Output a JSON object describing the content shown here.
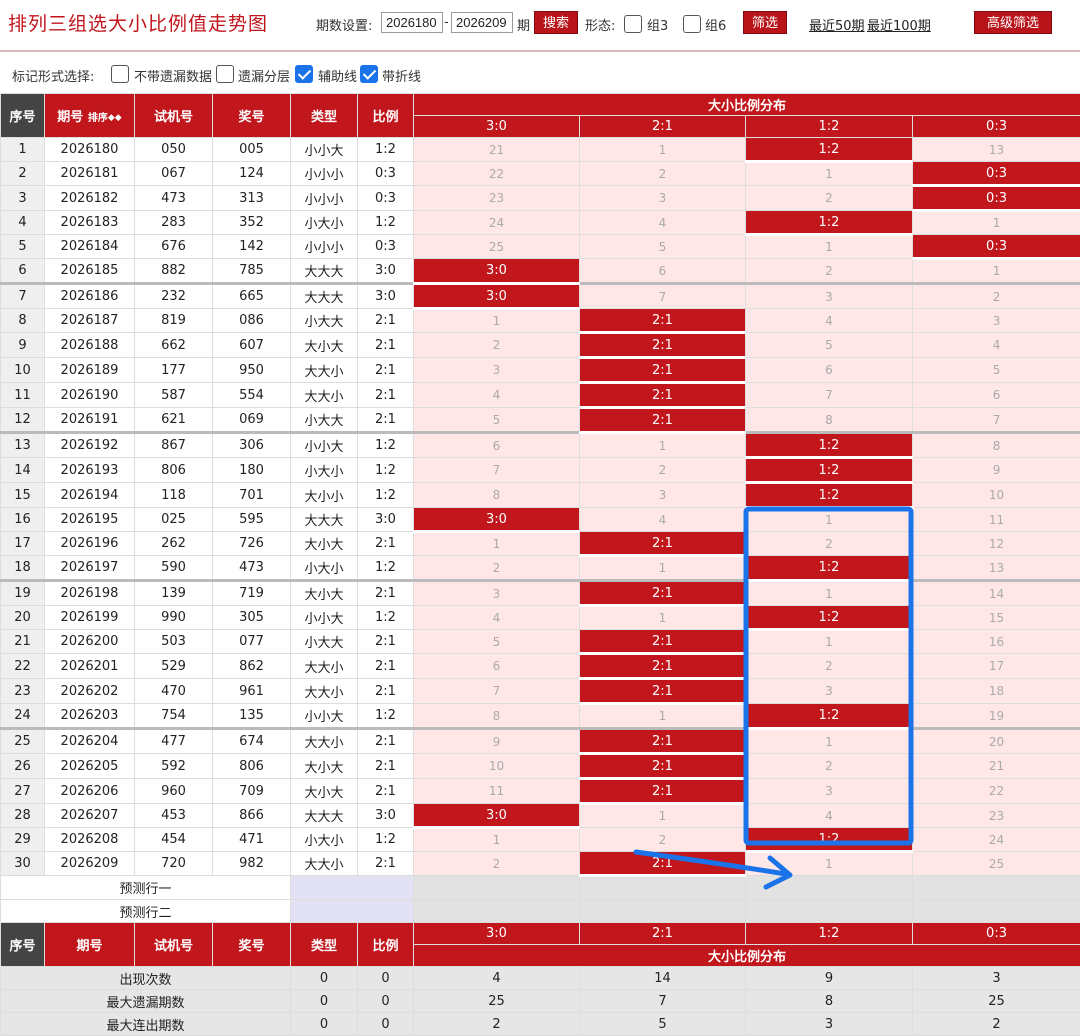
{
  "header": {
    "title": "排列三组选大小比例值走势图",
    "period_label": "期数设置:",
    "period_from": "2026180",
    "period_sep": "-",
    "period_to": "2026209",
    "period_unit": "期",
    "search_label": "搜索",
    "form_label": "形态:",
    "group3_label": "组3",
    "group6_label": "组6",
    "filter_label": "筛选",
    "recent50_label": "最近50期",
    "recent100_label": "最近100期",
    "advanced_label": "高级筛选"
  },
  "options": {
    "label": "标记形式选择:",
    "items": [
      {
        "label": "不带遗漏数据",
        "checked": false
      },
      {
        "label": "遗漏分层",
        "checked": false
      },
      {
        "label": "辅助线",
        "checked": true
      },
      {
        "label": "带折线",
        "checked": true
      }
    ]
  },
  "table": {
    "headers": {
      "seq": "序号",
      "period": "期号",
      "sort": "排序",
      "trial": "试机号",
      "prize": "奖号",
      "type": "类型",
      "ratio": "比例",
      "dist": "大小比例分布"
    },
    "dist_cols": [
      "3:0",
      "2:1",
      "1:2",
      "0:3"
    ],
    "rows": [
      {
        "seq": "1",
        "period": "2026180",
        "trial": "050",
        "prize": "005",
        "type": "小小大",
        "ratio": "1:2",
        "dist": [
          "21",
          "1",
          "1:2",
          "13"
        ],
        "hit": 2
      },
      {
        "seq": "2",
        "period": "2026181",
        "trial": "067",
        "prize": "124",
        "type": "小小小",
        "ratio": "0:3",
        "dist": [
          "22",
          "2",
          "1",
          "0:3"
        ],
        "hit": 3
      },
      {
        "seq": "3",
        "period": "2026182",
        "trial": "473",
        "prize": "313",
        "type": "小小小",
        "ratio": "0:3",
        "dist": [
          "23",
          "3",
          "2",
          "0:3"
        ],
        "hit": 3
      },
      {
        "seq": "4",
        "period": "2026183",
        "trial": "283",
        "prize": "352",
        "type": "小大小",
        "ratio": "1:2",
        "dist": [
          "24",
          "4",
          "1:2",
          "1"
        ],
        "hit": 2
      },
      {
        "seq": "5",
        "period": "2026184",
        "trial": "676",
        "prize": "142",
        "type": "小小小",
        "ratio": "0:3",
        "dist": [
          "25",
          "5",
          "1",
          "0:3"
        ],
        "hit": 3
      },
      {
        "seq": "6",
        "period": "2026185",
        "trial": "882",
        "prize": "785",
        "type": "大大大",
        "ratio": "3:0",
        "dist": [
          "3:0",
          "6",
          "2",
          "1"
        ],
        "hit": 0
      },
      {
        "seq": "7",
        "period": "2026186",
        "trial": "232",
        "prize": "665",
        "type": "大大大",
        "ratio": "3:0",
        "dist": [
          "3:0",
          "7",
          "3",
          "2"
        ],
        "hit": 0
      },
      {
        "seq": "8",
        "period": "2026187",
        "trial": "819",
        "prize": "086",
        "type": "小大大",
        "ratio": "2:1",
        "dist": [
          "1",
          "2:1",
          "4",
          "3"
        ],
        "hit": 1
      },
      {
        "seq": "9",
        "period": "2026188",
        "trial": "662",
        "prize": "607",
        "type": "大小大",
        "ratio": "2:1",
        "dist": [
          "2",
          "2:1",
          "5",
          "4"
        ],
        "hit": 1
      },
      {
        "seq": "10",
        "period": "2026189",
        "trial": "177",
        "prize": "950",
        "type": "大大小",
        "ratio": "2:1",
        "dist": [
          "3",
          "2:1",
          "6",
          "5"
        ],
        "hit": 1
      },
      {
        "seq": "11",
        "period": "2026190",
        "trial": "587",
        "prize": "554",
        "type": "大大小",
        "ratio": "2:1",
        "dist": [
          "4",
          "2:1",
          "7",
          "6"
        ],
        "hit": 1
      },
      {
        "seq": "12",
        "period": "2026191",
        "trial": "621",
        "prize": "069",
        "type": "小大大",
        "ratio": "2:1",
        "dist": [
          "5",
          "2:1",
          "8",
          "7"
        ],
        "hit": 1
      },
      {
        "seq": "13",
        "period": "2026192",
        "trial": "867",
        "prize": "306",
        "type": "小小大",
        "ratio": "1:2",
        "dist": [
          "6",
          "1",
          "1:2",
          "8"
        ],
        "hit": 2
      },
      {
        "seq": "14",
        "period": "2026193",
        "trial": "806",
        "prize": "180",
        "type": "小大小",
        "ratio": "1:2",
        "dist": [
          "7",
          "2",
          "1:2",
          "9"
        ],
        "hit": 2
      },
      {
        "seq": "15",
        "period": "2026194",
        "trial": "118",
        "prize": "701",
        "type": "大小小",
        "ratio": "1:2",
        "dist": [
          "8",
          "3",
          "1:2",
          "10"
        ],
        "hit": 2
      },
      {
        "seq": "16",
        "period": "2026195",
        "trial": "025",
        "prize": "595",
        "type": "大大大",
        "ratio": "3:0",
        "dist": [
          "3:0",
          "4",
          "1",
          "11"
        ],
        "hit": 0
      },
      {
        "seq": "17",
        "period": "2026196",
        "trial": "262",
        "prize": "726",
        "type": "大小大",
        "ratio": "2:1",
        "dist": [
          "1",
          "2:1",
          "2",
          "12"
        ],
        "hit": 1
      },
      {
        "seq": "18",
        "period": "2026197",
        "trial": "590",
        "prize": "473",
        "type": "小大小",
        "ratio": "1:2",
        "dist": [
          "2",
          "1",
          "1:2",
          "13"
        ],
        "hit": 2
      },
      {
        "seq": "19",
        "period": "2026198",
        "trial": "139",
        "prize": "719",
        "type": "大小大",
        "ratio": "2:1",
        "dist": [
          "3",
          "2:1",
          "1",
          "14"
        ],
        "hit": 1
      },
      {
        "seq": "20",
        "period": "2026199",
        "trial": "990",
        "prize": "305",
        "type": "小小大",
        "ratio": "1:2",
        "dist": [
          "4",
          "1",
          "1:2",
          "15"
        ],
        "hit": 2
      },
      {
        "seq": "21",
        "period": "2026200",
        "trial": "503",
        "prize": "077",
        "type": "小大大",
        "ratio": "2:1",
        "dist": [
          "5",
          "2:1",
          "1",
          "16"
        ],
        "hit": 1
      },
      {
        "seq": "22",
        "period": "2026201",
        "trial": "529",
        "prize": "862",
        "type": "大大小",
        "ratio": "2:1",
        "dist": [
          "6",
          "2:1",
          "2",
          "17"
        ],
        "hit": 1
      },
      {
        "seq": "23",
        "period": "2026202",
        "trial": "470",
        "prize": "961",
        "type": "大大小",
        "ratio": "2:1",
        "dist": [
          "7",
          "2:1",
          "3",
          "18"
        ],
        "hit": 1
      },
      {
        "seq": "24",
        "period": "2026203",
        "trial": "754",
        "prize": "135",
        "type": "小小大",
        "ratio": "1:2",
        "dist": [
          "8",
          "1",
          "1:2",
          "19"
        ],
        "hit": 2
      },
      {
        "seq": "25",
        "period": "2026204",
        "trial": "477",
        "prize": "674",
        "type": "大大小",
        "ratio": "2:1",
        "dist": [
          "9",
          "2:1",
          "1",
          "20"
        ],
        "hit": 1
      },
      {
        "seq": "26",
        "period": "2026205",
        "trial": "592",
        "prize": "806",
        "type": "大小大",
        "ratio": "2:1",
        "dist": [
          "10",
          "2:1",
          "2",
          "21"
        ],
        "hit": 1
      },
      {
        "seq": "27",
        "period": "2026206",
        "trial": "960",
        "prize": "709",
        "type": "大小大",
        "ratio": "2:1",
        "dist": [
          "11",
          "2:1",
          "3",
          "22"
        ],
        "hit": 1
      },
      {
        "seq": "28",
        "period": "2026207",
        "trial": "453",
        "prize": "866",
        "type": "大大大",
        "ratio": "3:0",
        "dist": [
          "3:0",
          "1",
          "4",
          "23"
        ],
        "hit": 0
      },
      {
        "seq": "29",
        "period": "2026208",
        "trial": "454",
        "prize": "471",
        "type": "小大小",
        "ratio": "1:2",
        "dist": [
          "1",
          "2",
          "1:2",
          "24"
        ],
        "hit": 2
      },
      {
        "seq": "30",
        "period": "2026209",
        "trial": "720",
        "prize": "982",
        "type": "大大小",
        "ratio": "2:1",
        "dist": [
          "2",
          "2:1",
          "1",
          "25"
        ],
        "hit": 1
      }
    ],
    "group_starts": [
      6,
      12,
      18,
      24
    ],
    "predict_rows": [
      "预测行一",
      "预测行二"
    ],
    "stats": [
      {
        "label": "出现次数",
        "type": "0",
        "ratio": "0",
        "dist": [
          "4",
          "14",
          "9",
          "3"
        ]
      },
      {
        "label": "最大遗漏期数",
        "type": "0",
        "ratio": "0",
        "dist": [
          "25",
          "7",
          "8",
          "25"
        ]
      },
      {
        "label": "最大连出期数",
        "type": "0",
        "ratio": "0",
        "dist": [
          "2",
          "5",
          "3",
          "2"
        ]
      }
    ]
  },
  "colors": {
    "accent_red": "#c1161c",
    "annotation_blue": "#1a73e8"
  }
}
